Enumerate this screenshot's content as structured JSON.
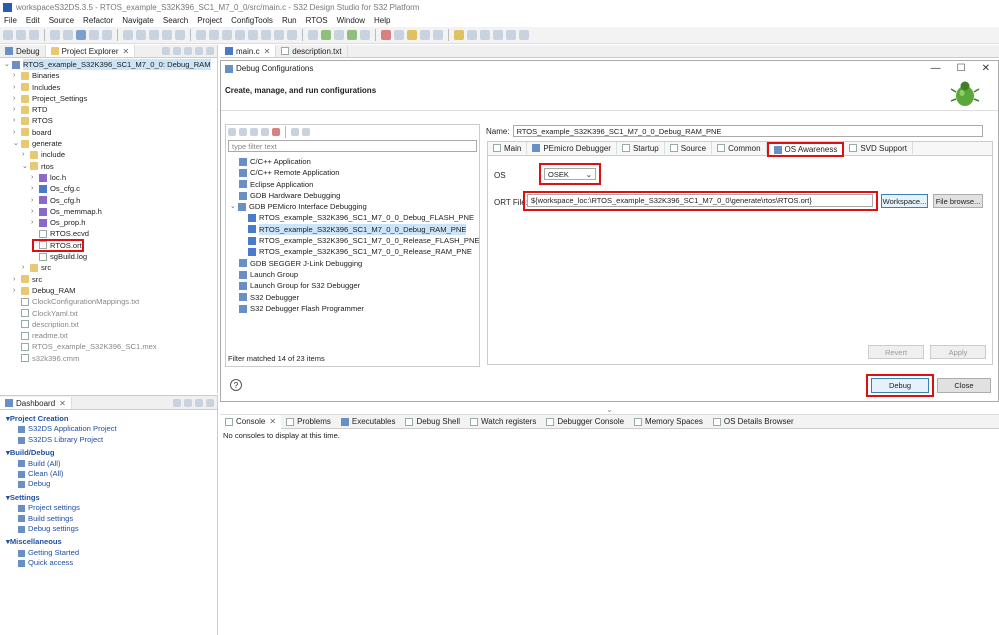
{
  "window": {
    "title": "workspaceS32DS.3.5 - RTOS_example_S32K396_SC1_M7_0_0/src/main.c - S32 Design Studio for S32 Platform"
  },
  "menu": [
    "File",
    "Edit",
    "Source",
    "Refactor",
    "Navigate",
    "Search",
    "Project",
    "ConfigTools",
    "Run",
    "RTOS",
    "Window",
    "Help"
  ],
  "left_tabs": {
    "debug": "Debug",
    "explorer": "Project Explorer"
  },
  "editor_tabs": [
    "main.c",
    "description.txt"
  ],
  "tree": [
    {
      "label": "RTOS_example_S32K396_SC1_M7_0_0: Debug_RAM",
      "indent": 0,
      "twisty": "v",
      "icon": "proj"
    },
    {
      "label": "Binaries",
      "indent": 1,
      "twisty": ">",
      "icon": "folder"
    },
    {
      "label": "Includes",
      "indent": 1,
      "twisty": ">",
      "icon": "folder"
    },
    {
      "label": "Project_Settings",
      "indent": 1,
      "twisty": ">",
      "icon": "folder"
    },
    {
      "label": "RTD",
      "indent": 1,
      "twisty": ">",
      "icon": "folder"
    },
    {
      "label": "RTOS",
      "indent": 1,
      "twisty": ">",
      "icon": "folder"
    },
    {
      "label": "board",
      "indent": 1,
      "twisty": ">",
      "icon": "folder"
    },
    {
      "label": "generate",
      "indent": 1,
      "twisty": "v",
      "icon": "folder"
    },
    {
      "label": "include",
      "indent": 2,
      "twisty": ">",
      "icon": "folder"
    },
    {
      "label": "rtos",
      "indent": 2,
      "twisty": "v",
      "icon": "folder"
    },
    {
      "label": "loc.h",
      "indent": 3,
      "twisty": ">",
      "icon": "hfile"
    },
    {
      "label": "Os_cfg.c",
      "indent": 3,
      "twisty": ">",
      "icon": "cfile"
    },
    {
      "label": "Os_cfg.h",
      "indent": 3,
      "twisty": ">",
      "icon": "hfile"
    },
    {
      "label": "Os_memmap.h",
      "indent": 3,
      "twisty": ">",
      "icon": "hfile"
    },
    {
      "label": "Os_prop.h",
      "indent": 3,
      "twisty": ">",
      "icon": "hfile"
    },
    {
      "label": "RTOS.ecvd",
      "indent": 3,
      "twisty": "",
      "icon": "file"
    },
    {
      "label": "RTOS.ort",
      "indent": 3,
      "twisty": "",
      "icon": "file"
    },
    {
      "label": "sgBuild.log",
      "indent": 3,
      "twisty": "",
      "icon": "file"
    },
    {
      "label": "src",
      "indent": 2,
      "twisty": ">",
      "icon": "folder"
    },
    {
      "label": "src",
      "indent": 1,
      "twisty": ">",
      "icon": "folder"
    },
    {
      "label": "Debug_RAM",
      "indent": 1,
      "twisty": ">",
      "icon": "folder"
    },
    {
      "label": "ClockConfigurationMappings.txt",
      "indent": 1,
      "twisty": "",
      "icon": "file",
      "gray": true
    },
    {
      "label": "ClockYaml.txt",
      "indent": 1,
      "twisty": "",
      "icon": "file",
      "gray": true
    },
    {
      "label": "description.txt",
      "indent": 1,
      "twisty": "",
      "icon": "file",
      "gray": true
    },
    {
      "label": "readme.txt",
      "indent": 1,
      "twisty": "",
      "icon": "file",
      "gray": true
    },
    {
      "label": "RTOS_example_S32K396_SC1.mex",
      "indent": 1,
      "twisty": "",
      "icon": "file",
      "gray": true
    },
    {
      "label": "s32k396.cmm",
      "indent": 1,
      "twisty": "",
      "icon": "file",
      "gray": true
    }
  ],
  "dashboard": {
    "title": "Dashboard",
    "sections": [
      {
        "head": "Project Creation",
        "items": [
          "S32DS Application Project",
          "S32DS Library Project"
        ]
      },
      {
        "head": "Build/Debug",
        "items": [
          "Build  (All)",
          "Clean  (All)",
          "Debug"
        ]
      },
      {
        "head": "Settings",
        "items": [
          "Project settings",
          "Build settings",
          "Debug settings"
        ]
      },
      {
        "head": "Miscellaneous",
        "items": [
          "Getting Started",
          "Quick access"
        ]
      }
    ]
  },
  "dialog": {
    "title": "Debug Configurations",
    "heading": "Create, manage, and run configurations",
    "filter_placeholder": "type filter text",
    "config_tree": [
      {
        "label": "C/C++ Application",
        "indent": 1
      },
      {
        "label": "C/C++ Remote Application",
        "indent": 1
      },
      {
        "label": "Eclipse Application",
        "indent": 1
      },
      {
        "label": "GDB Hardware Debugging",
        "indent": 1
      },
      {
        "label": "GDB PEMicro Interface Debugging",
        "indent": 0,
        "twisty": "v"
      },
      {
        "label": "RTOS_example_S32K396_SC1_M7_0_0_Debug_FLASH_PNE",
        "indent": 2
      },
      {
        "label": "RTOS_example_S32K396_SC1_M7_0_0_Debug_RAM_PNE",
        "indent": 2,
        "selected": true
      },
      {
        "label": "RTOS_example_S32K396_SC1_M7_0_0_Release_FLASH_PNE",
        "indent": 2
      },
      {
        "label": "RTOS_example_S32K396_SC1_M7_0_0_Release_RAM_PNE",
        "indent": 2
      },
      {
        "label": "GDB SEGGER J-Link Debugging",
        "indent": 1
      },
      {
        "label": "Launch Group",
        "indent": 1
      },
      {
        "label": "Launch Group for S32 Debugger",
        "indent": 1
      },
      {
        "label": "S32 Debugger",
        "indent": 1
      },
      {
        "label": "S32 Debugger Flash Programmer",
        "indent": 1
      }
    ],
    "filter_status": "Filter matched 14 of 23 items",
    "name_label": "Name:",
    "name_value": "RTOS_example_S32K396_SC1_M7_0_0_Debug_RAM_PNE",
    "tabs": [
      "Main",
      "PEmicro Debugger",
      "Startup",
      "Source",
      "Common",
      "OS Awareness",
      "SVD Support"
    ],
    "os_label": "OS",
    "os_value": "OSEK",
    "ort_label": "ORT File:",
    "ort_value": "${workspace_loc:\\RTOS_example_S32K396_SC1_M7_0_0\\generate\\rtos\\RTOS.ort}",
    "workspace_btn": "Workspace...",
    "filebrowse_btn": "File browse...",
    "revert_btn": "Revert",
    "apply_btn": "Apply",
    "debug_btn": "Debug",
    "close_btn": "Close"
  },
  "console": {
    "tabs": [
      "Console",
      "Problems",
      "Executables",
      "Debug Shell",
      "Watch registers",
      "Debugger Console",
      "Memory Spaces",
      "OS Details Browser"
    ],
    "message": "No consoles to display at this time."
  }
}
